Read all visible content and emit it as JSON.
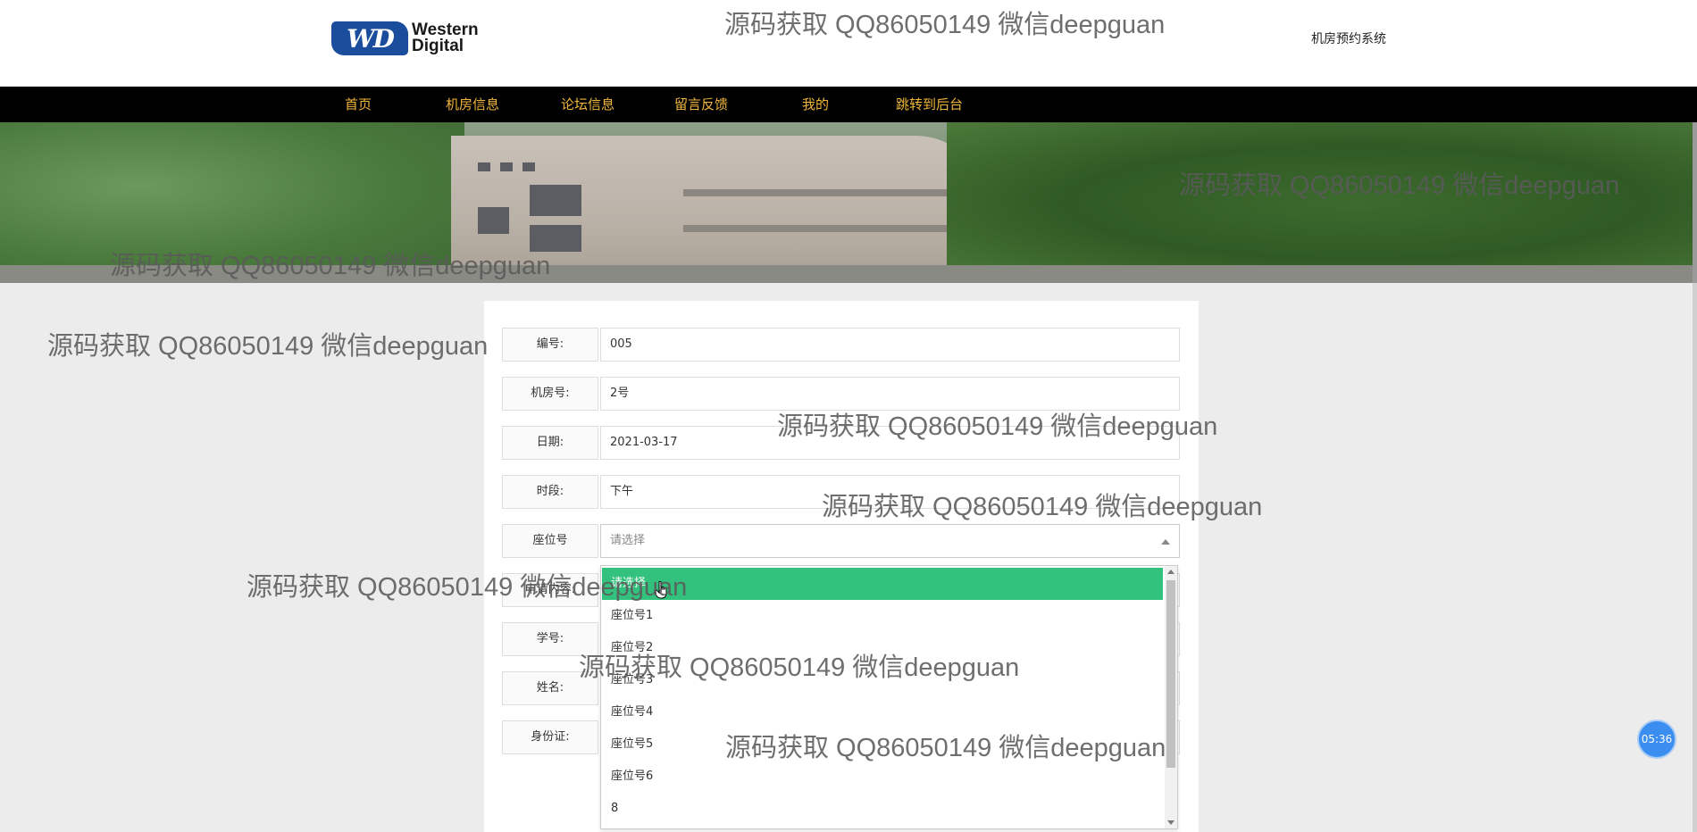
{
  "header": {
    "logo_mark": "WD",
    "logo_line1": "Western",
    "logo_line2": "Digital",
    "site_title": "机房预约系统"
  },
  "nav": {
    "items": [
      "首页",
      "机房信息",
      "论坛信息",
      "留言反馈",
      "我的",
      "跳转到后台"
    ],
    "color": "#f0b63a"
  },
  "form": {
    "fields": [
      {
        "label": "编号:",
        "value": "005"
      },
      {
        "label": "机房号:",
        "value": "2号"
      },
      {
        "label": "日期:",
        "value": "2021-03-17"
      },
      {
        "label": "时段:",
        "value": "下午"
      },
      {
        "label": "座位号",
        "placeholder": "请选择"
      },
      {
        "label": "申请内容:"
      },
      {
        "label": "学号:"
      },
      {
        "label": "姓名:"
      },
      {
        "label": "身份证:"
      }
    ]
  },
  "dropdown": {
    "options": [
      "请选择",
      "座位号1",
      "座位号2",
      "座位号3",
      "座位号4",
      "座位号5",
      "座位号6",
      "8"
    ],
    "selected_index": 0,
    "selected_color": "#33c27e"
  },
  "clock": {
    "time": "05:36"
  },
  "watermark": {
    "text": "源码获取 QQ86050149 微信deepguan"
  }
}
